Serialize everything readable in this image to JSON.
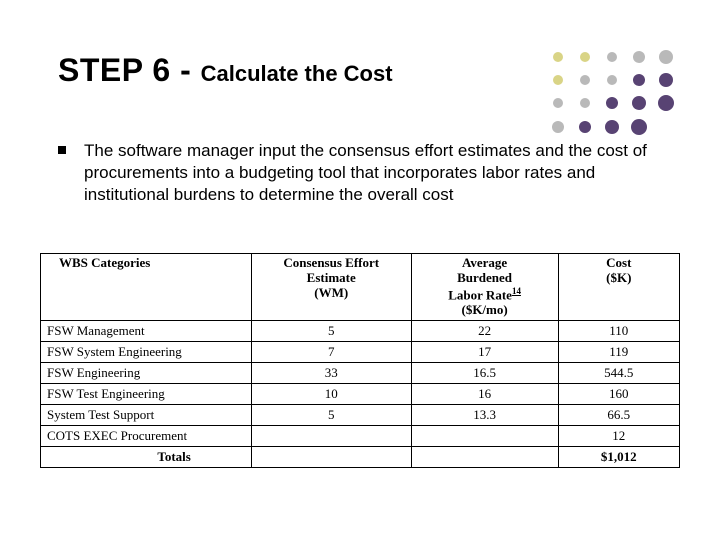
{
  "title": {
    "step": "STEP 6",
    "dash": " - ",
    "rest": "Calculate the Cost"
  },
  "bullet": "The software manager input the consensus effort estimates and the cost of procurements into a budgeting tool that incorporates labor rates and institutional burdens to determine the overall cost",
  "table": {
    "headers": {
      "wbs": "WBS Categories",
      "effort_l1": "Consensus Effort Estimate",
      "effort_l2": "(WM)",
      "rate_l1": "Average",
      "rate_l2": "Burdened",
      "rate_l3": "Labor Rate",
      "rate_sup": "14",
      "rate_l4": "($K/mo)",
      "cost_l1": "Cost",
      "cost_l2": "($K)"
    },
    "rows": [
      {
        "wbs": "FSW Management",
        "effort": "5",
        "rate": "22",
        "cost": "110"
      },
      {
        "wbs": "FSW System Engineering",
        "effort": "7",
        "rate": "17",
        "cost": "119"
      },
      {
        "wbs": "FSW Engineering",
        "effort": "33",
        "rate": "16.5",
        "cost": "544.5"
      },
      {
        "wbs": "FSW Test Engineering",
        "effort": "10",
        "rate": "16",
        "cost": "160"
      },
      {
        "wbs": "System Test Support",
        "effort": "5",
        "rate": "13.3",
        "cost": "66.5"
      },
      {
        "wbs": "COTS EXEC Procurement",
        "effort": "",
        "rate": "",
        "cost": "12"
      }
    ],
    "footer": {
      "label": "Totals",
      "effort": "",
      "rate": "",
      "cost": "$1,012"
    }
  }
}
